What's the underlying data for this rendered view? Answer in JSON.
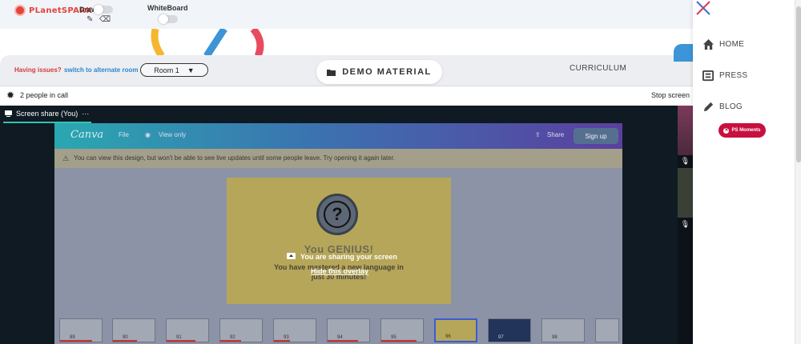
{
  "app": {
    "brand": "PLanetSPARK"
  },
  "toolbar": {
    "draw_label": "Draw",
    "whiteboard_label": "WhiteBoard"
  },
  "room_bar": {
    "issue_text": "Having issues?",
    "switch_text": "switch to alternate room",
    "room_value": "Room 1",
    "demo_label": "DEMO MATERIAL",
    "curriculum_label": "CURRICULUM"
  },
  "call": {
    "people_count": "2 people in call",
    "stop_label": "Stop screen",
    "share_tab": "Screen share (You)",
    "more": "···"
  },
  "canva": {
    "logo": "Canva",
    "file": "File",
    "view_only": "View only",
    "share": "Share",
    "sign_up": "Sign up",
    "warning": "You can view this design, but won't be able to see live updates until some people leave. Try opening it again later."
  },
  "slide": {
    "title": "You       GENIUS!",
    "subtitle": "You have mastered a new language in just 30 minutes!"
  },
  "overlay": {
    "message": "You are sharing your screen",
    "hide_link": "Hide this overlay"
  },
  "thumbnails": [
    {
      "num": "89"
    },
    {
      "num": "90"
    },
    {
      "num": "91"
    },
    {
      "num": "92"
    },
    {
      "num": "93"
    },
    {
      "num": "94"
    },
    {
      "num": "95"
    },
    {
      "num": "96"
    },
    {
      "num": "97"
    },
    {
      "num": "98"
    },
    {
      "num": ""
    }
  ],
  "sidebar": {
    "items": [
      {
        "label": "HOME"
      },
      {
        "label": "PRESS"
      },
      {
        "label": "BLOG"
      }
    ],
    "moments_label": "PS Moments"
  },
  "colors": {
    "accent_red": "#c8103e",
    "link_blue": "#2b86d3",
    "share_teal": "#2ec4b6"
  }
}
